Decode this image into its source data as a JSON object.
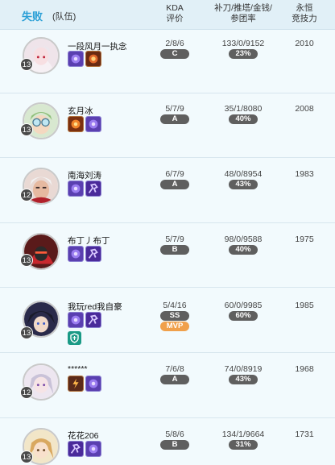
{
  "header": {
    "result": "失败",
    "team": "(队伍)",
    "kda_line1": "KDA",
    "kda_line2": "评价",
    "stats_line1": "补刀/推塔/金钱/",
    "stats_line2": "参团率",
    "power_line1": "永恒",
    "power_line2": "竞技力"
  },
  "players": [
    {
      "name": "一段风月一执念",
      "level": "13",
      "kda": "2/8/6",
      "grade": "C",
      "stats": "133/0/9152",
      "rate": "23%",
      "power": "2010"
    },
    {
      "name": "玄月冰",
      "level": "13",
      "kda": "5/7/9",
      "grade": "A",
      "stats": "35/1/8080",
      "rate": "40%",
      "power": "2008"
    },
    {
      "name": "南海刘涛",
      "level": "12",
      "kda": "6/7/9",
      "grade": "A",
      "stats": "48/0/8954",
      "rate": "43%",
      "power": "1983"
    },
    {
      "name": "布丁丿布丁",
      "level": "13",
      "kda": "5/7/9",
      "grade": "B",
      "stats": "98/0/9588",
      "rate": "40%",
      "power": "1975"
    },
    {
      "name": "我玩red我自豪",
      "level": "13",
      "kda": "5/4/16",
      "grade": "SS",
      "mvp": "MVP",
      "stats": "60/0/9985",
      "rate": "60%",
      "power": "1985"
    },
    {
      "name": "******",
      "level": "12",
      "kda": "7/6/8",
      "grade": "A",
      "stats": "74/0/8919",
      "rate": "43%",
      "power": "1968"
    },
    {
      "name": "花花206",
      "level": "13",
      "kda": "5/8/6",
      "grade": "B",
      "stats": "134/1/9664",
      "rate": "31%",
      "power": "1731"
    }
  ]
}
